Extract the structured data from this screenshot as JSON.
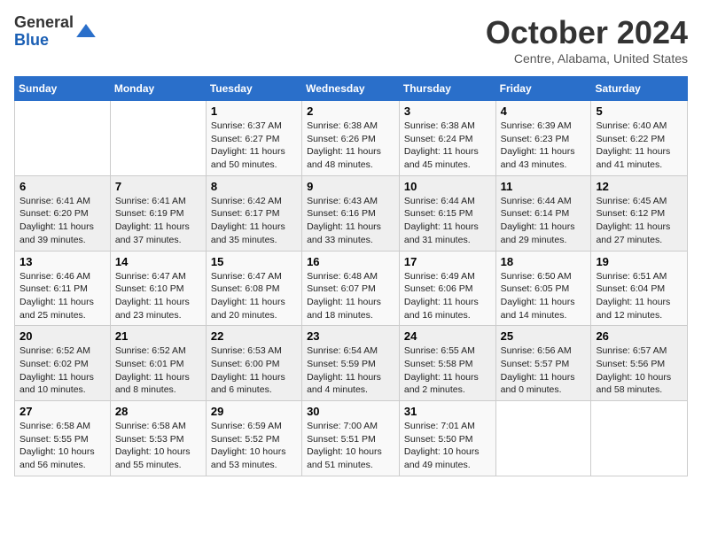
{
  "logo": {
    "general": "General",
    "blue": "Blue"
  },
  "title": "October 2024",
  "location": "Centre, Alabama, United States",
  "days_of_week": [
    "Sunday",
    "Monday",
    "Tuesday",
    "Wednesday",
    "Thursday",
    "Friday",
    "Saturday"
  ],
  "weeks": [
    [
      {
        "day": "",
        "content": ""
      },
      {
        "day": "",
        "content": ""
      },
      {
        "day": "1",
        "content": "Sunrise: 6:37 AM\nSunset: 6:27 PM\nDaylight: 11 hours and 50 minutes."
      },
      {
        "day": "2",
        "content": "Sunrise: 6:38 AM\nSunset: 6:26 PM\nDaylight: 11 hours and 48 minutes."
      },
      {
        "day": "3",
        "content": "Sunrise: 6:38 AM\nSunset: 6:24 PM\nDaylight: 11 hours and 45 minutes."
      },
      {
        "day": "4",
        "content": "Sunrise: 6:39 AM\nSunset: 6:23 PM\nDaylight: 11 hours and 43 minutes."
      },
      {
        "day": "5",
        "content": "Sunrise: 6:40 AM\nSunset: 6:22 PM\nDaylight: 11 hours and 41 minutes."
      }
    ],
    [
      {
        "day": "6",
        "content": "Sunrise: 6:41 AM\nSunset: 6:20 PM\nDaylight: 11 hours and 39 minutes."
      },
      {
        "day": "7",
        "content": "Sunrise: 6:41 AM\nSunset: 6:19 PM\nDaylight: 11 hours and 37 minutes."
      },
      {
        "day": "8",
        "content": "Sunrise: 6:42 AM\nSunset: 6:17 PM\nDaylight: 11 hours and 35 minutes."
      },
      {
        "day": "9",
        "content": "Sunrise: 6:43 AM\nSunset: 6:16 PM\nDaylight: 11 hours and 33 minutes."
      },
      {
        "day": "10",
        "content": "Sunrise: 6:44 AM\nSunset: 6:15 PM\nDaylight: 11 hours and 31 minutes."
      },
      {
        "day": "11",
        "content": "Sunrise: 6:44 AM\nSunset: 6:14 PM\nDaylight: 11 hours and 29 minutes."
      },
      {
        "day": "12",
        "content": "Sunrise: 6:45 AM\nSunset: 6:12 PM\nDaylight: 11 hours and 27 minutes."
      }
    ],
    [
      {
        "day": "13",
        "content": "Sunrise: 6:46 AM\nSunset: 6:11 PM\nDaylight: 11 hours and 25 minutes."
      },
      {
        "day": "14",
        "content": "Sunrise: 6:47 AM\nSunset: 6:10 PM\nDaylight: 11 hours and 23 minutes."
      },
      {
        "day": "15",
        "content": "Sunrise: 6:47 AM\nSunset: 6:08 PM\nDaylight: 11 hours and 20 minutes."
      },
      {
        "day": "16",
        "content": "Sunrise: 6:48 AM\nSunset: 6:07 PM\nDaylight: 11 hours and 18 minutes."
      },
      {
        "day": "17",
        "content": "Sunrise: 6:49 AM\nSunset: 6:06 PM\nDaylight: 11 hours and 16 minutes."
      },
      {
        "day": "18",
        "content": "Sunrise: 6:50 AM\nSunset: 6:05 PM\nDaylight: 11 hours and 14 minutes."
      },
      {
        "day": "19",
        "content": "Sunrise: 6:51 AM\nSunset: 6:04 PM\nDaylight: 11 hours and 12 minutes."
      }
    ],
    [
      {
        "day": "20",
        "content": "Sunrise: 6:52 AM\nSunset: 6:02 PM\nDaylight: 11 hours and 10 minutes."
      },
      {
        "day": "21",
        "content": "Sunrise: 6:52 AM\nSunset: 6:01 PM\nDaylight: 11 hours and 8 minutes."
      },
      {
        "day": "22",
        "content": "Sunrise: 6:53 AM\nSunset: 6:00 PM\nDaylight: 11 hours and 6 minutes."
      },
      {
        "day": "23",
        "content": "Sunrise: 6:54 AM\nSunset: 5:59 PM\nDaylight: 11 hours and 4 minutes."
      },
      {
        "day": "24",
        "content": "Sunrise: 6:55 AM\nSunset: 5:58 PM\nDaylight: 11 hours and 2 minutes."
      },
      {
        "day": "25",
        "content": "Sunrise: 6:56 AM\nSunset: 5:57 PM\nDaylight: 11 hours and 0 minutes."
      },
      {
        "day": "26",
        "content": "Sunrise: 6:57 AM\nSunset: 5:56 PM\nDaylight: 10 hours and 58 minutes."
      }
    ],
    [
      {
        "day": "27",
        "content": "Sunrise: 6:58 AM\nSunset: 5:55 PM\nDaylight: 10 hours and 56 minutes."
      },
      {
        "day": "28",
        "content": "Sunrise: 6:58 AM\nSunset: 5:53 PM\nDaylight: 10 hours and 55 minutes."
      },
      {
        "day": "29",
        "content": "Sunrise: 6:59 AM\nSunset: 5:52 PM\nDaylight: 10 hours and 53 minutes."
      },
      {
        "day": "30",
        "content": "Sunrise: 7:00 AM\nSunset: 5:51 PM\nDaylight: 10 hours and 51 minutes."
      },
      {
        "day": "31",
        "content": "Sunrise: 7:01 AM\nSunset: 5:50 PM\nDaylight: 10 hours and 49 minutes."
      },
      {
        "day": "",
        "content": ""
      },
      {
        "day": "",
        "content": ""
      }
    ]
  ]
}
